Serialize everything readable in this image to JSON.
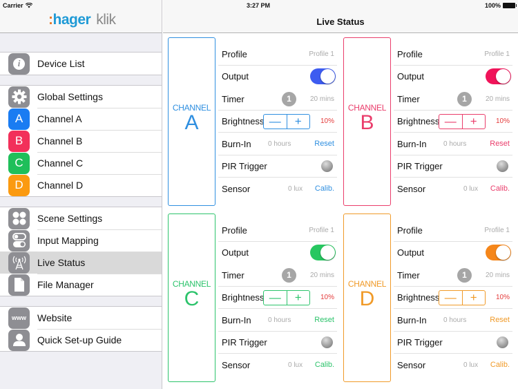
{
  "status_bar": {
    "carrier": "Carrier",
    "wifi_icon": "wifi-icon",
    "time": "3:27 PM",
    "battery": "100%"
  },
  "sidebar": {
    "logo": {
      "colon": ":",
      "brand": "hager",
      "product": "klik"
    },
    "groups": [
      {
        "items": [
          {
            "label": "Device List",
            "icon": "info-icon",
            "glyph": "i",
            "color": "#8e8e93"
          }
        ]
      },
      {
        "items": [
          {
            "label": "Global Settings",
            "icon": "gear-icon",
            "glyph": "⚙",
            "color": "#8e8e93"
          },
          {
            "label": "Channel A",
            "icon": "channel-a-icon",
            "glyph": "A",
            "color": "#1a7cf2"
          },
          {
            "label": "Channel B",
            "icon": "channel-b-icon",
            "glyph": "B",
            "color": "#f2305a"
          },
          {
            "label": "Channel C",
            "icon": "channel-c-icon",
            "glyph": "C",
            "color": "#1fbf5a"
          },
          {
            "label": "Channel D",
            "icon": "channel-d-icon",
            "glyph": "D",
            "color": "#fb9a10"
          }
        ]
      },
      {
        "items": [
          {
            "label": "Scene Settings",
            "icon": "scene-dots-icon",
            "glyph": "⁘",
            "color": "#8e8e93"
          },
          {
            "label": "Input Mapping",
            "icon": "input-toggles-icon",
            "glyph": "⊶",
            "color": "#8e8e93"
          },
          {
            "label": "Live Status",
            "icon": "antenna-icon",
            "glyph": "((Å))",
            "color": "#8e8e93",
            "selected": true
          },
          {
            "label": "File Manager",
            "icon": "file-icon",
            "glyph": "▮",
            "color": "#8e8e93"
          }
        ]
      },
      {
        "items": [
          {
            "label": "Website",
            "icon": "www-icon",
            "glyph": "www",
            "color": "#8e8e93"
          },
          {
            "label": "Quick Set-up Guide",
            "icon": "person-icon",
            "glyph": "👤",
            "color": "#8e8e93"
          }
        ]
      }
    ]
  },
  "main": {
    "title": "Live Status",
    "row_labels": {
      "profile": "Profile",
      "output": "Output",
      "timer": "Timer",
      "brightness": "Brightness",
      "burn_in": "Burn-In",
      "pir": "PIR Trigger",
      "sensor": "Sensor"
    },
    "channel_word": "CHANNEL",
    "channels": [
      {
        "letter": "A",
        "color": "#2f8fe0",
        "toggle_color": "#3d5cf0",
        "profile": "Profile 1",
        "output_on": true,
        "timer_badge": "1",
        "timer": "20 mins",
        "minus": "—",
        "plus": "+",
        "brightness": "10%",
        "burn_in": "0 hours",
        "reset": "Reset",
        "sensor": "0 lux",
        "calib": "Calib."
      },
      {
        "letter": "B",
        "color": "#ea3d6b",
        "toggle_color": "#f0145a",
        "profile": "Profile 1",
        "output_on": true,
        "timer_badge": "1",
        "timer": "20 mins",
        "minus": "—",
        "plus": "+",
        "brightness": "10%",
        "burn_in": "0 hours",
        "reset": "Reset",
        "sensor": "0 lux",
        "calib": "Calib."
      },
      {
        "letter": "C",
        "color": "#2cc36b",
        "toggle_color": "#27c760",
        "profile": "Profile 1",
        "output_on": true,
        "timer_badge": "1",
        "timer": "20 mins",
        "minus": "—",
        "plus": "+",
        "brightness": "10%",
        "burn_in": "0 hours",
        "reset": "Reset",
        "sensor": "0 lux",
        "calib": "Calib."
      },
      {
        "letter": "D",
        "color": "#f09a28",
        "toggle_color": "#f5861a",
        "profile": "Profile 1",
        "output_on": true,
        "timer_badge": "1",
        "timer": "20 mins",
        "minus": "—",
        "plus": "+",
        "brightness": "10%",
        "burn_in": "0 hours",
        "reset": "Reset",
        "sensor": "0 lux",
        "calib": "Calib."
      }
    ]
  }
}
